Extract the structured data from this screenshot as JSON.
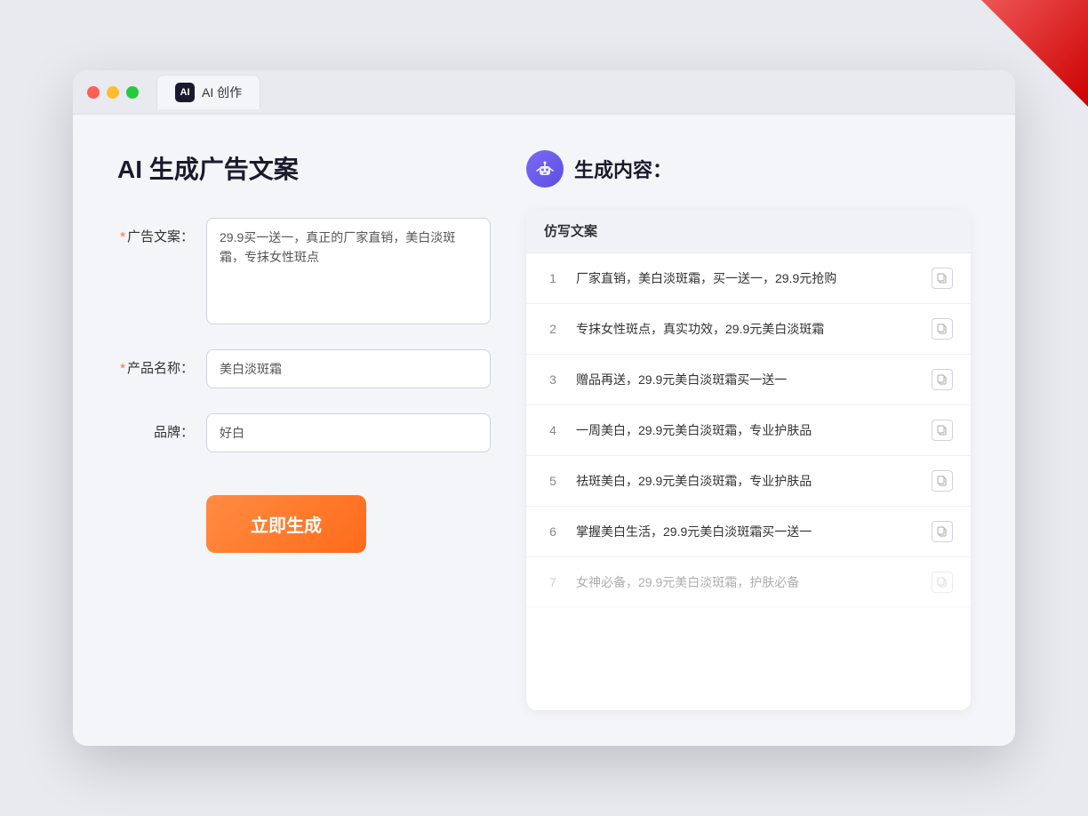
{
  "browser": {
    "tab_label": "AI 创作",
    "tab_icon": "AI"
  },
  "page": {
    "title": "AI 生成广告文案",
    "result_title": "生成内容："
  },
  "form": {
    "ad_copy_label": "广告文案：",
    "ad_copy_required": "*",
    "ad_copy_value": "29.9买一送一，真正的厂家直销，美白淡斑霜，专抹女性斑点",
    "product_name_label": "产品名称：",
    "product_name_required": "*",
    "product_name_value": "美白淡斑霜",
    "brand_label": "品牌：",
    "brand_value": "好白",
    "generate_button": "立即生成"
  },
  "result": {
    "table_header": "仿写文案",
    "items": [
      {
        "num": "1",
        "text": "厂家直销，美白淡斑霜，买一送一，29.9元抢购"
      },
      {
        "num": "2",
        "text": "专抹女性斑点，真实功效，29.9元美白淡斑霜"
      },
      {
        "num": "3",
        "text": "赠品再送，29.9元美白淡斑霜买一送一"
      },
      {
        "num": "4",
        "text": "一周美白，29.9元美白淡斑霜，专业护肤品"
      },
      {
        "num": "5",
        "text": "祛斑美白，29.9元美白淡斑霜，专业护肤品"
      },
      {
        "num": "6",
        "text": "掌握美白生活，29.9元美白淡斑霜买一送一"
      },
      {
        "num": "7",
        "text": "女神必备，29.9元美白淡斑霜，护肤必备",
        "faded": true
      }
    ]
  }
}
